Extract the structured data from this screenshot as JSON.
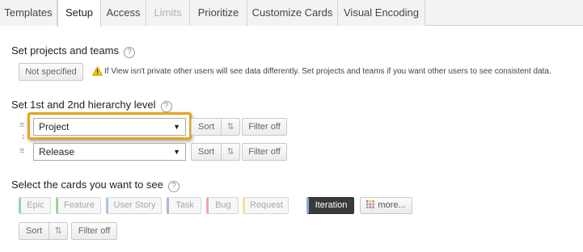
{
  "tabs": [
    {
      "label": "Templates",
      "state": "normal"
    },
    {
      "label": "Setup",
      "state": "active"
    },
    {
      "label": "Access",
      "state": "normal"
    },
    {
      "label": "Limits",
      "state": "disabled"
    },
    {
      "label": "Prioritize",
      "state": "normal"
    },
    {
      "label": "Customize Cards",
      "state": "normal"
    },
    {
      "label": "Visual Encoding",
      "state": "normal"
    }
  ],
  "projects": {
    "heading": "Set projects and teams",
    "help": "?",
    "button": "Not specified",
    "warning": "If View isn't private other users will see data differently. Set projects and teams if you want other users to see consistent data."
  },
  "hierarchy": {
    "heading": "Set 1st and 2nd hierarchy level",
    "help": "?",
    "levels": [
      {
        "value": "Project",
        "sort": "Sort",
        "filter": "Filter off"
      },
      {
        "value": "Release",
        "sort": "Sort",
        "filter": "Filter off"
      }
    ]
  },
  "cards": {
    "heading": "Select the cards you want to see",
    "help": "?",
    "types": [
      {
        "label": "Epic",
        "accent": "#8fd3c1",
        "selected": false
      },
      {
        "label": "Feature",
        "accent": "#9fd49a",
        "selected": false
      },
      {
        "label": "User Story",
        "accent": "#a9c6e6",
        "selected": false
      },
      {
        "label": "Task",
        "accent": "#b9b0d8",
        "selected": false
      },
      {
        "label": "Bug",
        "accent": "#f0a5a5",
        "selected": false
      },
      {
        "label": "Request",
        "accent": "#efe39a",
        "selected": false
      },
      {
        "label": "Iteration",
        "accent": "#8fb0d8",
        "selected": true
      }
    ],
    "more": "more...",
    "sort": "Sort",
    "filter": "Filter off"
  },
  "colors": {
    "highlight": "#e9a21b",
    "warning_icon": "#f2c200"
  }
}
